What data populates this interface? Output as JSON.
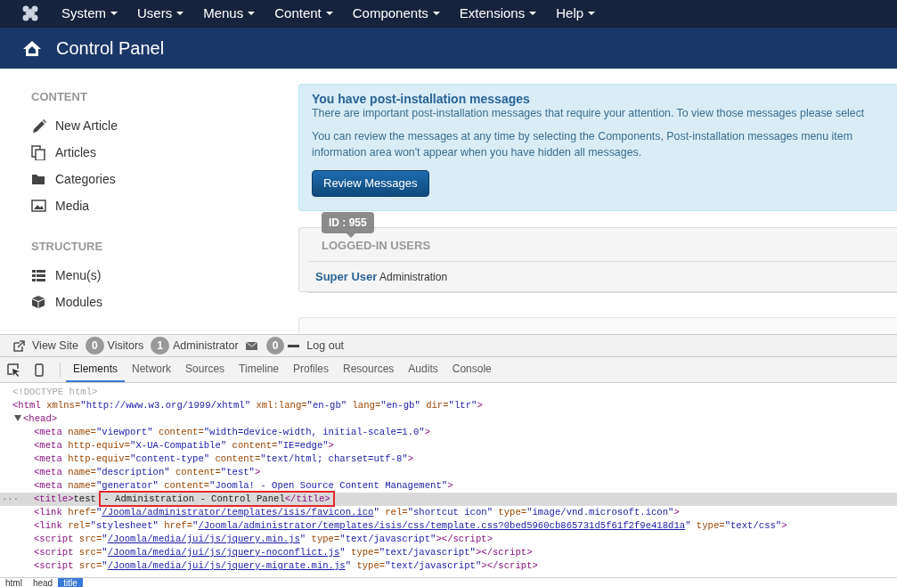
{
  "top_menu": [
    {
      "label": "System"
    },
    {
      "label": "Users"
    },
    {
      "label": "Menus"
    },
    {
      "label": "Content"
    },
    {
      "label": "Components"
    },
    {
      "label": "Extensions"
    },
    {
      "label": "Help"
    }
  ],
  "page_title": "Control Panel",
  "sidebar": [
    {
      "heading": "CONTENT",
      "items": [
        {
          "label": "New Article"
        },
        {
          "label": "Articles"
        },
        {
          "label": "Categories"
        },
        {
          "label": "Media"
        }
      ]
    },
    {
      "heading": "STRUCTURE",
      "items": [
        {
          "label": "Menu(s)"
        },
        {
          "label": "Modules"
        }
      ]
    }
  ],
  "alert": {
    "title": "You have post-installation messages",
    "lines": [
      "There are important post-installation messages that require your attention. To view those messages please select"
    ],
    "lines2": [
      "You can review the messages at any time by selecting the Components, Post-installation messages menu item",
      "information area won't appear when you have hidden all messages."
    ],
    "button": "Review Messages"
  },
  "logged_in": {
    "heading": "LOGGED-IN USERS",
    "tooltip": "ID : 955",
    "user": "Super User",
    "area": "Administration"
  },
  "status_bar": [
    {
      "kind": "link",
      "label": "View Site"
    },
    {
      "kind": "count",
      "count": "0",
      "label": "Visitors"
    },
    {
      "kind": "count",
      "count": "1",
      "label": "Administrator"
    },
    {
      "kind": "icon"
    },
    {
      "kind": "count",
      "count": "0"
    },
    {
      "kind": "link",
      "label": "Log out"
    }
  ],
  "devtools": {
    "tabs": [
      {
        "label": "Elements",
        "selected": true
      },
      {
        "label": "Network",
        "selected": false
      },
      {
        "label": "Sources",
        "selected": false
      },
      {
        "label": "Timeline",
        "selected": false
      },
      {
        "label": "Profiles",
        "selected": false
      },
      {
        "label": "Resources",
        "selected": false
      },
      {
        "label": "Audits",
        "selected": false
      },
      {
        "label": "Console",
        "selected": false
      }
    ],
    "dom": [
      {
        "selected": false,
        "tokens": [
          {
            "kind": "doctype",
            "text": "<!DOCTYPE html>"
          }
        ]
      },
      {
        "selected": false,
        "tokens": [
          {
            "kind": "tag",
            "text": "<html"
          },
          {
            "kind": "attr",
            "text": " xmlns="
          },
          {
            "kind": "value",
            "text": "\"http://www.w3.org/1999/xhtml\""
          },
          {
            "kind": "attr",
            "text": " xml:lang="
          },
          {
            "kind": "value",
            "text": "\"en-gb\""
          },
          {
            "kind": "attr",
            "text": " lang="
          },
          {
            "kind": "value",
            "text": "\"en-gb\""
          },
          {
            "kind": "attr",
            "text": " dir="
          },
          {
            "kind": "value",
            "text": "\"ltr\""
          },
          {
            "kind": "tag",
            "text": ">"
          }
        ],
        "children": [
          {
            "selected": false,
            "expanded": true,
            "tokens": [
              {
                "kind": "tag",
                "text": "<head>"
              }
            ],
            "children": [
              {
                "selected": false,
                "tokens": [
                  {
                    "kind": "tag",
                    "text": "<meta"
                  },
                  {
                    "kind": "attr",
                    "text": " name="
                  },
                  {
                    "kind": "value",
                    "text": "\"viewport\""
                  },
                  {
                    "kind": "attr",
                    "text": " content="
                  },
                  {
                    "kind": "value",
                    "text": "\"width=device-width, initial-scale=1.0\""
                  },
                  {
                    "kind": "tag",
                    "text": ">"
                  }
                ]
              },
              {
                "selected": false,
                "tokens": [
                  {
                    "kind": "tag",
                    "text": "<meta"
                  },
                  {
                    "kind": "attr",
                    "text": " http-equiv="
                  },
                  {
                    "kind": "value",
                    "text": "\"X-UA-Compatible\""
                  },
                  {
                    "kind": "attr",
                    "text": " content="
                  },
                  {
                    "kind": "value",
                    "text": "\"IE=edge\""
                  },
                  {
                    "kind": "tag",
                    "text": ">"
                  }
                ]
              },
              {
                "selected": false,
                "tokens": [
                  {
                    "kind": "tag",
                    "text": "<meta"
                  },
                  {
                    "kind": "attr",
                    "text": " http-equiv="
                  },
                  {
                    "kind": "value",
                    "text": "\"content-type\""
                  },
                  {
                    "kind": "attr",
                    "text": " content="
                  },
                  {
                    "kind": "value",
                    "text": "\"text/html; charset=utf-8\""
                  },
                  {
                    "kind": "tag",
                    "text": ">"
                  }
                ]
              },
              {
                "selected": false,
                "tokens": [
                  {
                    "kind": "tag",
                    "text": "<meta"
                  },
                  {
                    "kind": "attr",
                    "text": " name="
                  },
                  {
                    "kind": "value",
                    "text": "\"description\""
                  },
                  {
                    "kind": "attr",
                    "text": " content="
                  },
                  {
                    "kind": "value",
                    "text": "\"test\""
                  },
                  {
                    "kind": "tag",
                    "text": ">"
                  }
                ]
              },
              {
                "selected": false,
                "tokens": [
                  {
                    "kind": "tag",
                    "text": "<meta"
                  },
                  {
                    "kind": "attr",
                    "text": " name="
                  },
                  {
                    "kind": "value",
                    "text": "\"generator\""
                  },
                  {
                    "kind": "attr",
                    "text": " content="
                  },
                  {
                    "kind": "value",
                    "text": "\"Joomla! - Open Source Content Management\""
                  },
                  {
                    "kind": "tag",
                    "text": ">"
                  }
                ]
              },
              {
                "selected": true,
                "gutter": "···",
                "tokens": [
                  {
                    "kind": "tag",
                    "text": "<title>"
                  },
                  {
                    "kind": "text",
                    "text": "test "
                  },
                  {
                    "kind": "text",
                    "text": "- Administration - Control Panel",
                    "boxed": true
                  },
                  {
                    "kind": "tag",
                    "text": "</title>",
                    "boxed": true
                  }
                ]
              },
              {
                "selected": false,
                "tokens": [
                  {
                    "kind": "tag",
                    "text": "<link"
                  },
                  {
                    "kind": "attr",
                    "text": " href="
                  },
                  {
                    "kind": "value",
                    "text": "\""
                  },
                  {
                    "kind": "link",
                    "text": "/Joomla/administrator/templates/isis/favicon.ico"
                  },
                  {
                    "kind": "value",
                    "text": "\""
                  },
                  {
                    "kind": "attr",
                    "text": " rel="
                  },
                  {
                    "kind": "value",
                    "text": "\"shortcut icon\""
                  },
                  {
                    "kind": "attr",
                    "text": " type="
                  },
                  {
                    "kind": "value",
                    "text": "\"image/vnd.microsoft.icon\""
                  },
                  {
                    "kind": "tag",
                    "text": ">"
                  }
                ]
              },
              {
                "selected": false,
                "tokens": [
                  {
                    "kind": "tag",
                    "text": "<link"
                  },
                  {
                    "kind": "attr",
                    "text": " rel="
                  },
                  {
                    "kind": "value",
                    "text": "\"stylesheet\""
                  },
                  {
                    "kind": "attr",
                    "text": " href="
                  },
                  {
                    "kind": "value",
                    "text": "\""
                  },
                  {
                    "kind": "link",
                    "text": "/Joomla/administrator/templates/isis/css/template.css?0bed5960cb865731d5f61f2f9e418d1a"
                  },
                  {
                    "kind": "value",
                    "text": "\""
                  },
                  {
                    "kind": "attr",
                    "text": " type="
                  },
                  {
                    "kind": "value",
                    "text": "\"text/css\""
                  },
                  {
                    "kind": "tag",
                    "text": ">"
                  }
                ]
              },
              {
                "selected": false,
                "tokens": [
                  {
                    "kind": "tag",
                    "text": "<script"
                  },
                  {
                    "kind": "attr",
                    "text": " src="
                  },
                  {
                    "kind": "value",
                    "text": "\""
                  },
                  {
                    "kind": "link",
                    "text": "/Joomla/media/jui/js/jquery.min.js"
                  },
                  {
                    "kind": "value",
                    "text": "\""
                  },
                  {
                    "kind": "attr",
                    "text": " type="
                  },
                  {
                    "kind": "value",
                    "text": "\"text/javascript\""
                  },
                  {
                    "kind": "tag",
                    "text": "></script>"
                  }
                ]
              },
              {
                "selected": false,
                "tokens": [
                  {
                    "kind": "tag",
                    "text": "<script"
                  },
                  {
                    "kind": "attr",
                    "text": " src="
                  },
                  {
                    "kind": "value",
                    "text": "\""
                  },
                  {
                    "kind": "link",
                    "text": "/Joomla/media/jui/js/jquery-noconflict.js"
                  },
                  {
                    "kind": "value",
                    "text": "\""
                  },
                  {
                    "kind": "attr",
                    "text": " type="
                  },
                  {
                    "kind": "value",
                    "text": "\"text/javascript\""
                  },
                  {
                    "kind": "tag",
                    "text": "></script>"
                  }
                ]
              },
              {
                "selected": false,
                "tokens": [
                  {
                    "kind": "tag",
                    "text": "<script"
                  },
                  {
                    "kind": "attr",
                    "text": " src="
                  },
                  {
                    "kind": "value",
                    "text": "\""
                  },
                  {
                    "kind": "link",
                    "text": "/Joomla/media/jui/js/jquery-migrate.min.js"
                  },
                  {
                    "kind": "value",
                    "text": "\""
                  },
                  {
                    "kind": "attr",
                    "text": " type="
                  },
                  {
                    "kind": "value",
                    "text": "\"text/javascript\""
                  },
                  {
                    "kind": "tag",
                    "text": "></script>"
                  }
                ]
              }
            ]
          }
        ]
      }
    ],
    "breadcrumb": [
      {
        "label": "html",
        "selected": false
      },
      {
        "label": "head",
        "selected": false
      },
      {
        "label": "title",
        "selected": true
      }
    ]
  }
}
